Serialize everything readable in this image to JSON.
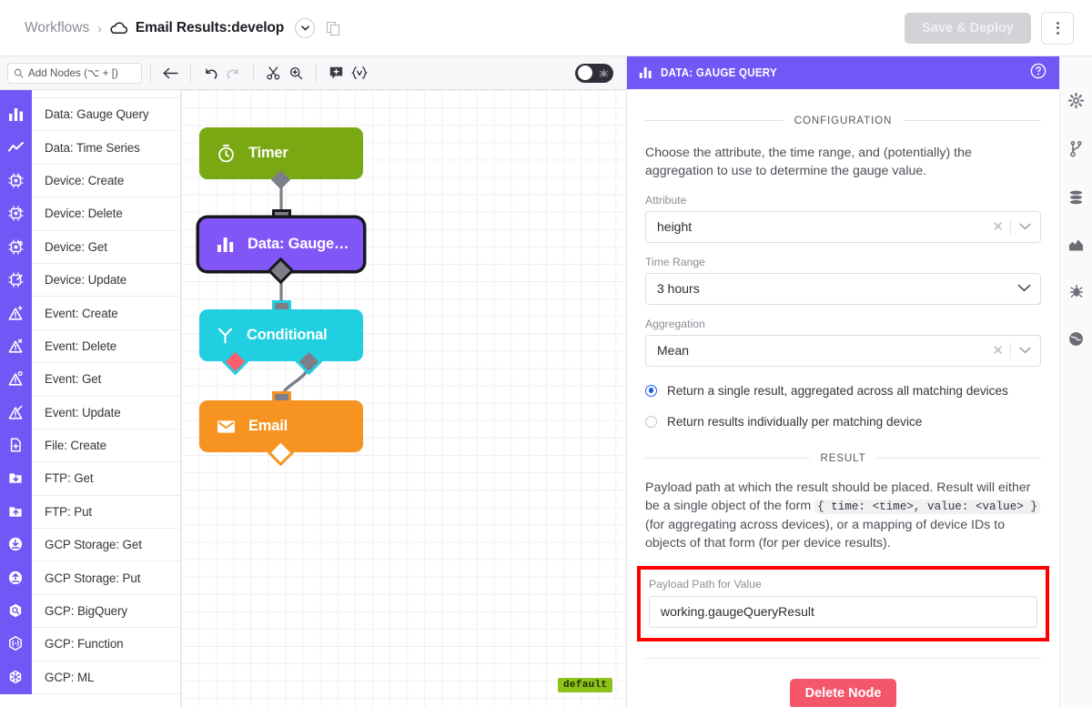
{
  "header": {
    "breadcrumb_root": "Workflows",
    "breadcrumb_sep": "›",
    "workflow_name": "Email Results:develop",
    "cloud_icon": "cloud-icon",
    "dropdown_icon": "chevron-down-icon",
    "duplicate_icon": "copy-icon",
    "save_deploy_label": "Save & Deploy",
    "kebab_icon": "more-vertical-icon"
  },
  "toolbar": {
    "search_placeholder": "Add Nodes (⌥ + [)",
    "search_icon": "search-icon",
    "back_icon": "arrow-left-icon",
    "undo_icon": "undo-icon",
    "redo_icon": "redo-icon",
    "cut_icon": "scissors-icon",
    "zoom_icon": "zoom-in-icon",
    "comment_icon": "add-comment-icon",
    "template_icon": "handlebars-icon",
    "debug_toggle_icon": "bug-icon",
    "debug_toggle_on": false
  },
  "node_palette": {
    "items": [
      {
        "label": "Data: Gauge Query",
        "icon": "bar-chart-icon"
      },
      {
        "label": "Data: Time Series",
        "icon": "line-chart-icon"
      },
      {
        "label": "Device: Create",
        "icon": "device-plus-icon"
      },
      {
        "label": "Device: Delete",
        "icon": "device-x-icon"
      },
      {
        "label": "Device: Get",
        "icon": "device-get-icon"
      },
      {
        "label": "Device: Update",
        "icon": "device-edit-icon"
      },
      {
        "label": "Event: Create",
        "icon": "alert-plus-icon"
      },
      {
        "label": "Event: Delete",
        "icon": "alert-x-icon"
      },
      {
        "label": "Event: Get",
        "icon": "alert-get-icon"
      },
      {
        "label": "Event: Update",
        "icon": "alert-edit-icon"
      },
      {
        "label": "File: Create",
        "icon": "file-plus-icon"
      },
      {
        "label": "FTP: Get",
        "icon": "folder-down-icon"
      },
      {
        "label": "FTP: Put",
        "icon": "folder-up-icon"
      },
      {
        "label": "GCP Storage: Get",
        "icon": "cloud-download-icon"
      },
      {
        "label": "GCP Storage: Put",
        "icon": "cloud-upload-icon"
      },
      {
        "label": "GCP: BigQuery",
        "icon": "hex-search-icon"
      },
      {
        "label": "GCP: Function",
        "icon": "hex-function-icon"
      },
      {
        "label": "GCP: ML",
        "icon": "hex-ml-icon"
      }
    ]
  },
  "canvas": {
    "nodes": [
      {
        "label": "Timer",
        "icon": "timer-icon",
        "color": "#7aa813",
        "selected": false
      },
      {
        "label": "Data: Gauge…",
        "icon": "bar-chart-icon",
        "color": "#8255f7",
        "selected": true
      },
      {
        "label": "Conditional",
        "icon": "branch-icon",
        "color": "#20cfe0",
        "selected": false
      },
      {
        "label": "Email",
        "icon": "envelope-icon",
        "color": "#f79421",
        "selected": false
      }
    ],
    "version_badge": "default"
  },
  "panel": {
    "title": "Data: Gauge Query",
    "title_icon": "bar-chart-icon",
    "help_icon": "help-circle-icon",
    "configuration_section": "CONFIGURATION",
    "configuration_desc": "Choose the attribute, the time range, and (potentially) the aggregation to use to determine the gauge value.",
    "fields": {
      "attribute": {
        "label": "Attribute",
        "value": "height",
        "clearable": true,
        "clear_icon": "close-icon",
        "chevron_icon": "chevron-down-icon"
      },
      "time_range": {
        "label": "Time Range",
        "value": "3 hours",
        "clearable": false,
        "chevron_icon": "chevron-down-icon"
      },
      "aggregation": {
        "label": "Aggregation",
        "value": "Mean",
        "clearable": true,
        "clear_icon": "close-icon",
        "chevron_icon": "chevron-down-icon"
      }
    },
    "radio_options": [
      {
        "label": "Return a single result, aggregated across all matching devices",
        "selected": true
      },
      {
        "label": "Return results individually per matching device",
        "selected": false
      }
    ],
    "result_section": "RESULT",
    "result_desc_1": "Payload path at which the result should be placed. Result will either be a single object of the form ",
    "result_code": "{ time: <time>, value: <value> }",
    "result_desc_2": " (for aggregating across devices), or a mapping of device IDs to objects of that form (for per device results).",
    "payload_field": {
      "label": "Payload Path for Value",
      "value": "working.gaugeQueryResult"
    },
    "delete_button": "Delete Node",
    "highlight_color": "#ff0000"
  },
  "rail": {
    "items": [
      {
        "icon": "gear-icon"
      },
      {
        "icon": "git-branch-icon"
      },
      {
        "icon": "database-icon"
      },
      {
        "icon": "area-chart-icon"
      },
      {
        "icon": "bug-icon"
      },
      {
        "icon": "globe-icon"
      }
    ]
  },
  "colors": {
    "brand_purple": "#7356f6",
    "node_green": "#7aa813",
    "node_purple": "#8255f7",
    "node_cyan": "#20cfe0",
    "node_orange": "#f79421",
    "danger_red": "#f4566a",
    "badge_green": "#8cc21a"
  }
}
